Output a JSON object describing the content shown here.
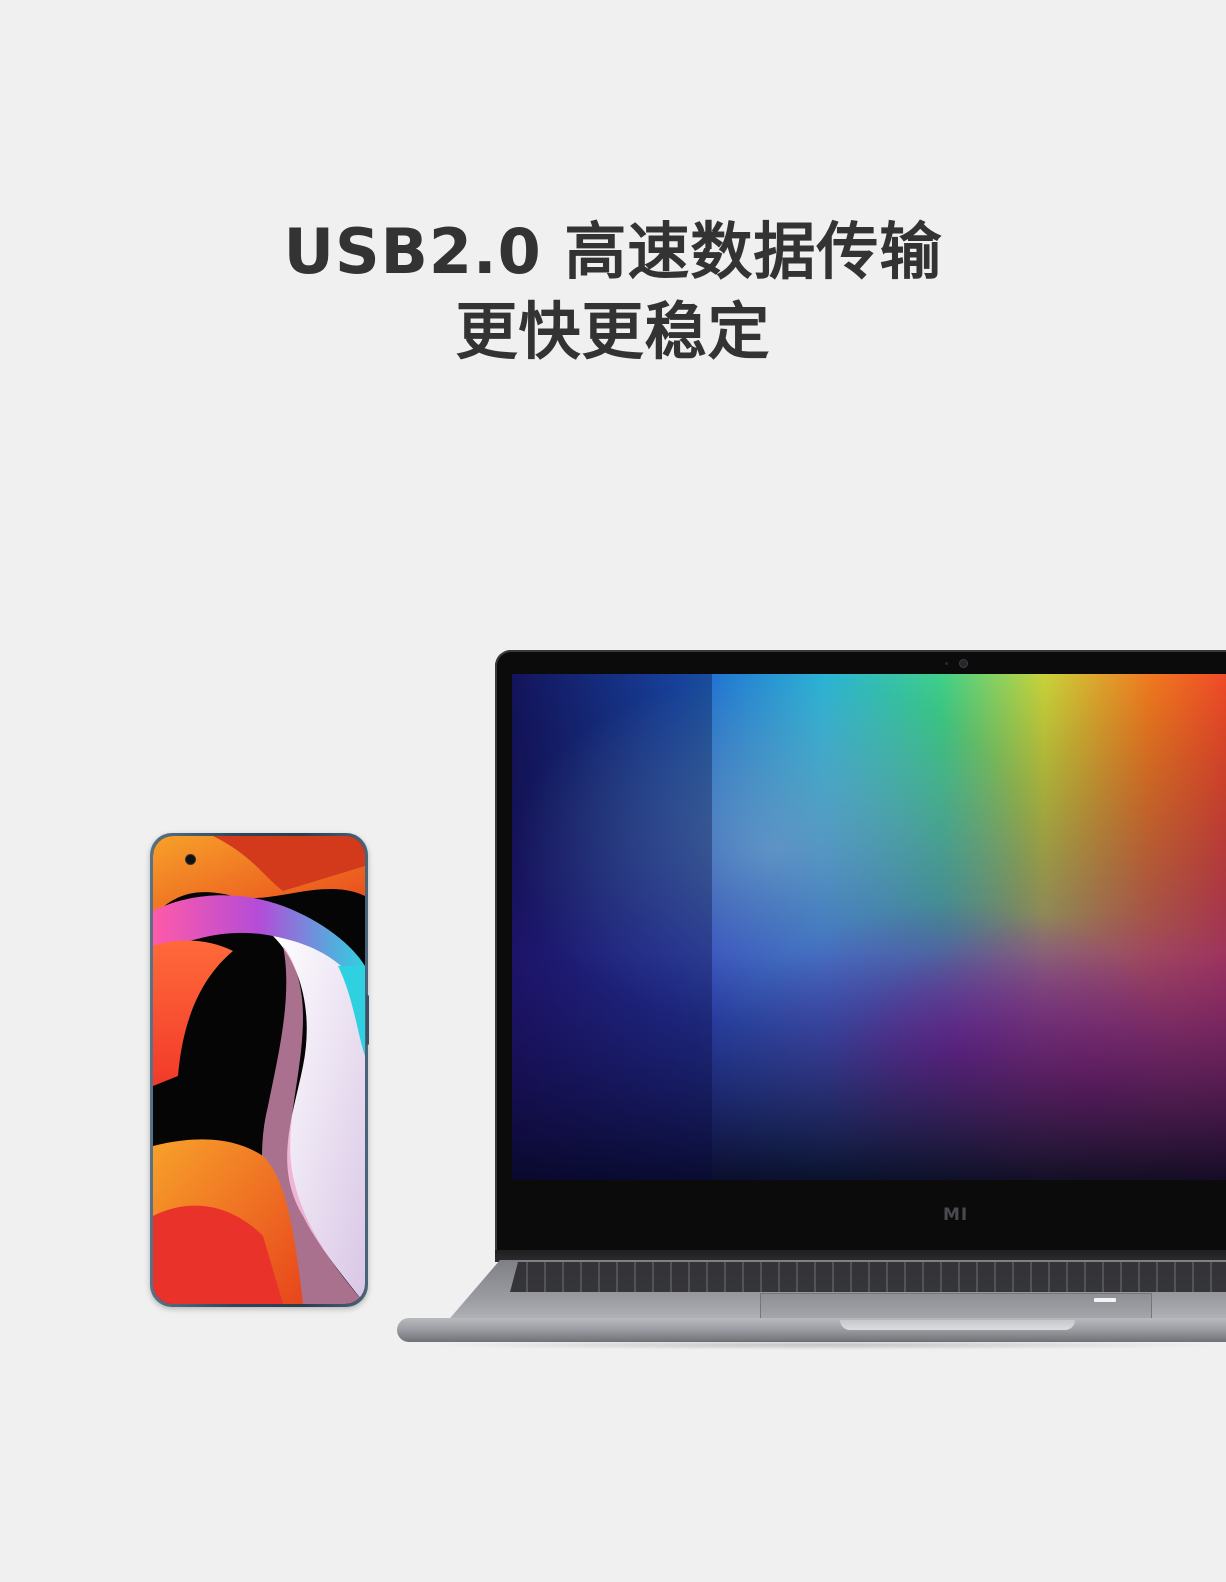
{
  "headline": {
    "line1": "USB2.0 高速数据传输",
    "line2": "更快更稳定"
  },
  "laptop": {
    "logo_text": "MI"
  },
  "colors": {
    "background": "#f0f0f0",
    "headline_text": "#333333",
    "laptop_bezel": "#0b0b0c",
    "laptop_body": "#9a9ca2",
    "phone_frame": "#2f4558"
  }
}
